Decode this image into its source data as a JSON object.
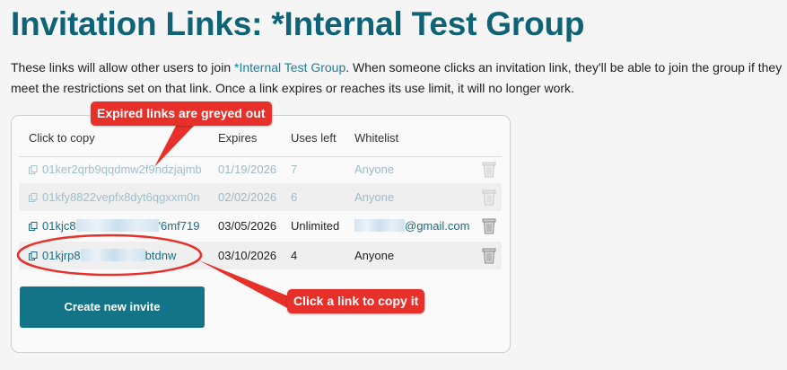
{
  "page": {
    "title": "Invitation Links: *Internal Test Group",
    "intro_before": "These links will allow other users to join ",
    "intro_link": "*Internal Test Group",
    "intro_after": ". When someone clicks an invitation link, they'll be able to join the group if they meet the restrictions set on that link. Once a link expires or reaches its use limit, it will no longer work."
  },
  "table": {
    "headers": [
      "Click to copy",
      "Expires",
      "Uses left",
      "Whitelist"
    ],
    "rows": [
      {
        "link": "01ker2qrb9qqdmw2f9ndzjajmb",
        "expires": "01/19/2026",
        "uses": "7",
        "whitelist": "Anyone",
        "state": "expired"
      },
      {
        "link": "01kfy8822vepfx8dyt6qgxxm0n",
        "expires": "02/02/2026",
        "uses": "6",
        "whitelist": "Anyone",
        "state": "expired"
      },
      {
        "link_start": "01kjc8",
        "link_end": "'6mf719",
        "expires": "03/05/2026",
        "uses": "Unlimited",
        "whitelist_end": "@gmail.com",
        "state": "active"
      },
      {
        "link_start": "01kjrp8",
        "link_end": "btdnw",
        "expires": "03/10/2026",
        "uses": "4",
        "whitelist": "Anyone",
        "state": "active"
      }
    ]
  },
  "create_button": "Create new invite",
  "callouts": {
    "expired": "Expired links are greyed out",
    "copy": "Click a link to copy it"
  },
  "colors": {
    "title": "#0e6376",
    "button": "#137487",
    "callout": "#e8302a",
    "link": "#1b6d85"
  },
  "icons": [
    "copy-icon",
    "trash-icon"
  ]
}
